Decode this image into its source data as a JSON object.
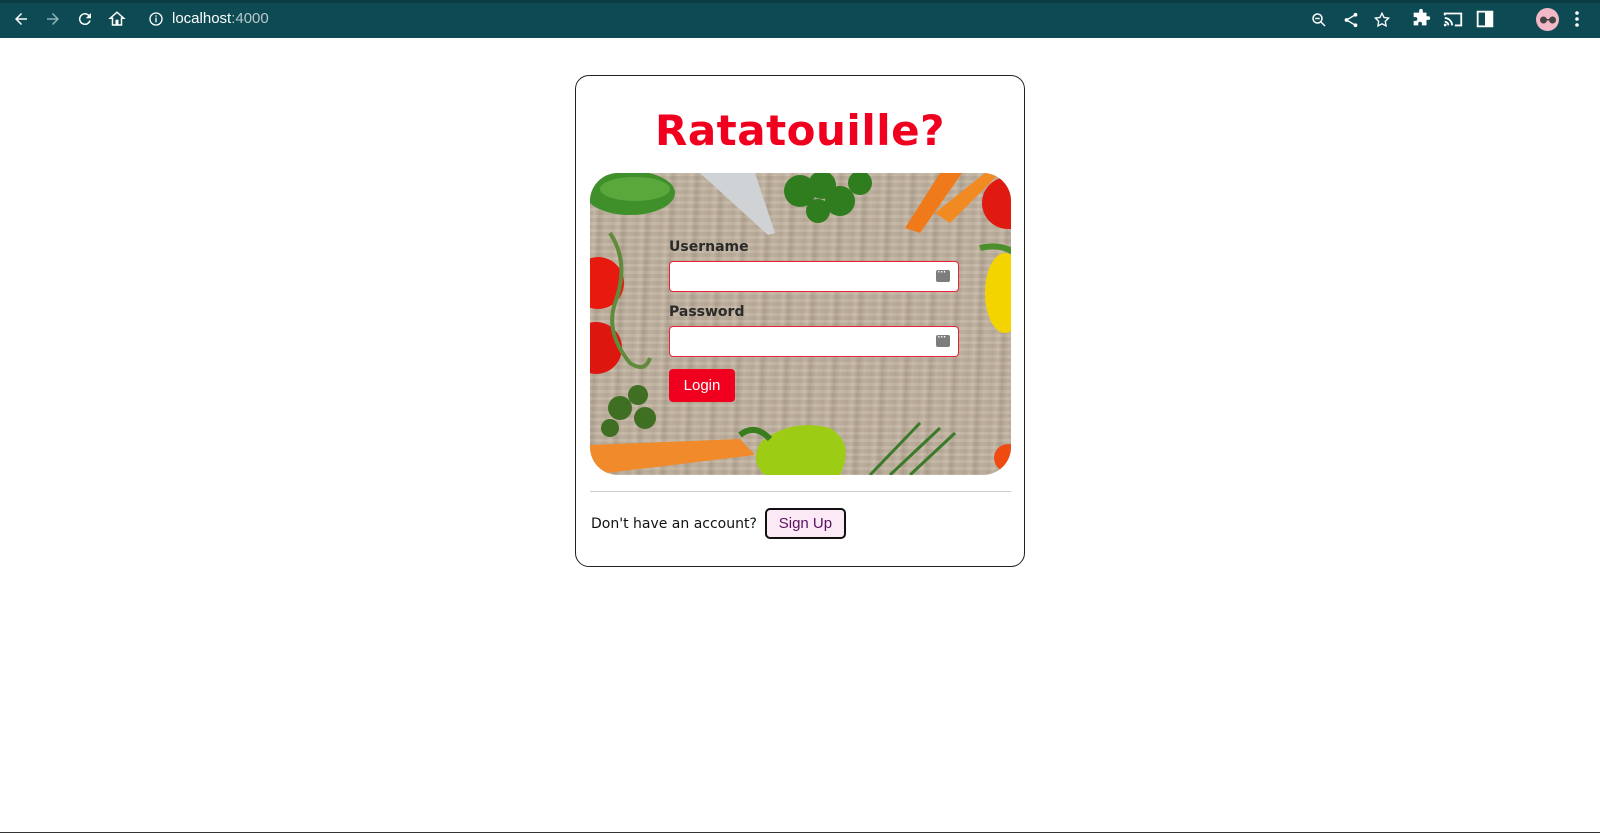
{
  "browser": {
    "url_host": "localhost",
    "url_port": ":4000",
    "colors": {
      "toolbar": "#0d4a54"
    },
    "icons": {
      "back": "arrow-left-icon",
      "forward": "arrow-right-icon",
      "reload": "reload-icon",
      "home": "home-icon",
      "site_info": "info-icon",
      "zoom": "zoom-icon",
      "share": "share-icon",
      "bookmark": "star-icon",
      "extensions": "puzzle-icon",
      "cast": "cast-icon",
      "side_panel": "side-panel-icon",
      "profile": "avatar-icon",
      "menu": "kebab-menu-icon"
    }
  },
  "page": {
    "title": "Ratatouille?",
    "colors": {
      "title": "#f0001e",
      "login_button": "#f0001e",
      "signup_button_bg": "#fbeaf6"
    },
    "form": {
      "username_label": "Username",
      "username_value": "",
      "password_label": "Password",
      "password_value": "",
      "login_label": "Login"
    },
    "footer": {
      "prompt": "Don't have an account?",
      "signup_label": "Sign Up"
    }
  }
}
